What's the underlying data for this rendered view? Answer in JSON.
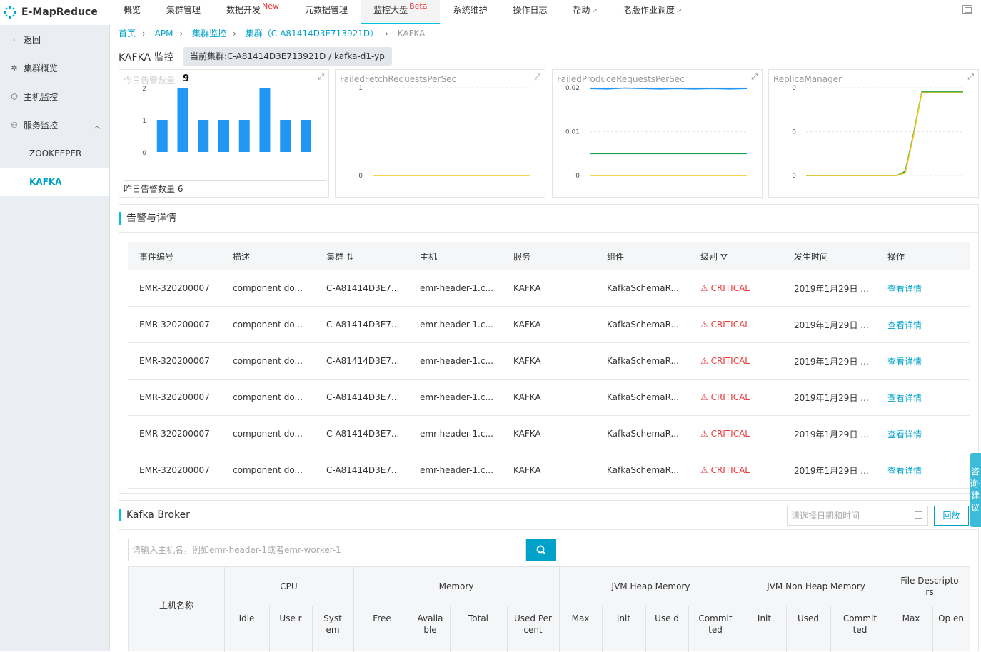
{
  "app": {
    "name": "E-MapReduce"
  },
  "nav": [
    {
      "label": "概览"
    },
    {
      "label": "集群管理"
    },
    {
      "label": "数据开发",
      "tag": "New"
    },
    {
      "label": "元数据管理"
    },
    {
      "label": "监控大盘",
      "tag": "Beta",
      "active": true
    },
    {
      "label": "系统维护"
    },
    {
      "label": "操作日志"
    },
    {
      "label": "帮助",
      "external": true
    },
    {
      "label": "老版作业调度",
      "external": true
    }
  ],
  "sidebar": {
    "back": "返回",
    "items": [
      {
        "label": "集群概览",
        "icon": "cluster-icon"
      },
      {
        "label": "主机监控",
        "icon": "host-icon"
      },
      {
        "label": "服务监控",
        "icon": "user-icon"
      }
    ],
    "subitems": [
      {
        "label": "ZOOKEEPER"
      },
      {
        "label": "KAFKA"
      }
    ]
  },
  "breadcrumb": {
    "items": [
      "首页",
      "APM",
      "集群监控",
      "集群（C-A81414D3E713921D）"
    ],
    "current": "KAFKA"
  },
  "page": {
    "title": "KAFKA 监控",
    "cluster_badge": "当前集群:C-A81414D3E713921D / kafka-d1-yp"
  },
  "charts": {
    "alert": {
      "title": "今日告警数量",
      "count": "9",
      "yesterday": "昨日告警数量 6"
    },
    "fetch": {
      "title": "FailedFetchRequestsPerSec"
    },
    "produce": {
      "title": "FailedProduceRequestsPerSec"
    },
    "replica": {
      "title": "ReplicaManager"
    }
  },
  "chart_data": [
    {
      "type": "bar",
      "title": "今日告警数量",
      "ylim": [
        0,
        2
      ],
      "yticks": [
        "0",
        "1",
        "2"
      ],
      "values": [
        1,
        2,
        1,
        1,
        1,
        2,
        1,
        1
      ],
      "color": "#2196f3"
    },
    {
      "type": "line",
      "title": "FailedFetchRequestsPerSec",
      "yticks": [
        "0",
        "1"
      ],
      "series": [
        {
          "values": [
            0,
            0,
            0,
            0,
            0,
            0,
            0,
            0,
            0,
            0
          ],
          "color": "#f5c518"
        }
      ]
    },
    {
      "type": "line",
      "title": "FailedProduceRequestsPerSec",
      "yticks": [
        "0",
        "0.01",
        "0.02"
      ],
      "ylim": [
        0,
        0.02
      ],
      "series": [
        {
          "values": [
            0.0198,
            0.0197,
            0.0199,
            0.0198,
            0.0197,
            0.0198,
            0.0197,
            0.0198,
            0.0197,
            0.0198
          ],
          "color": "#2196f3"
        },
        {
          "values": [
            0.005,
            0.005,
            0.005,
            0.005,
            0.005,
            0.005,
            0.005,
            0.005,
            0.005,
            0.005
          ],
          "color": "#1ba34a"
        },
        {
          "values": [
            0,
            0,
            0,
            0,
            0,
            0,
            0,
            0,
            0,
            0
          ],
          "color": "#f5c518"
        }
      ]
    },
    {
      "type": "line",
      "title": "ReplicaManager",
      "yticks": [
        "0",
        "0",
        "0"
      ],
      "series": [
        {
          "values": [
            0,
            0,
            0,
            0,
            0,
            0,
            0,
            0,
            0,
            0,
            0,
            0,
            0.05,
            0.5,
            1,
            1,
            1,
            1,
            1,
            1
          ],
          "color": "#1ba34a"
        },
        {
          "values": [
            0,
            0,
            0,
            0,
            0,
            0,
            0,
            0,
            0,
            0,
            0,
            0,
            0.03,
            0.48,
            0.99,
            0.99,
            0.99,
            0.99,
            0.99,
            0.99
          ],
          "color": "#f5c518"
        }
      ]
    }
  ],
  "alerts": {
    "title": "告警与详情",
    "columns": [
      "事件编号",
      "描述",
      "集群",
      "主机",
      "服务",
      "组件",
      "级别",
      "发生时间",
      "操作"
    ],
    "rows": [
      [
        "EMR-320200007",
        "component do...",
        "C-A81414D3E7...",
        "emr-header-1.c...",
        "KAFKA",
        "KafkaSchemaR...",
        "CRITICAL",
        "2019年1月29日 ...",
        "查看详情"
      ],
      [
        "EMR-320200007",
        "component do...",
        "C-A81414D3E7...",
        "emr-header-1.c...",
        "KAFKA",
        "KafkaSchemaR...",
        "CRITICAL",
        "2019年1月29日 ...",
        "查看详情"
      ],
      [
        "EMR-320200007",
        "component do...",
        "C-A81414D3E7...",
        "emr-header-1.c...",
        "KAFKA",
        "KafkaSchemaR...",
        "CRITICAL",
        "2019年1月29日 ...",
        "查看详情"
      ],
      [
        "EMR-320200007",
        "component do...",
        "C-A81414D3E7...",
        "emr-header-1.c...",
        "KAFKA",
        "KafkaSchemaR...",
        "CRITICAL",
        "2019年1月29日 ...",
        "查看详情"
      ],
      [
        "EMR-320200007",
        "component do...",
        "C-A81414D3E7...",
        "emr-header-1.c...",
        "KAFKA",
        "KafkaSchemaR...",
        "CRITICAL",
        "2019年1月29日 ...",
        "查看详情"
      ],
      [
        "EMR-320200007",
        "component do...",
        "C-A81414D3E7...",
        "emr-header-1.c...",
        "KAFKA",
        "KafkaSchemaR...",
        "CRITICAL",
        "2019年1月29日 ...",
        "查看详情"
      ]
    ]
  },
  "broker": {
    "title": "Kafka Broker",
    "date_placeholder": "请选择日期和时间",
    "replay": "回放",
    "search_placeholder": "请输入主机名，例如emr-header-1或者emr-worker-1",
    "host_col": "主机名称",
    "groups": [
      "CPU",
      "Memory",
      "JVM Heap Memory",
      "JVM Non Heap Memory",
      "File Descripto rs"
    ],
    "subcols": [
      "Idle",
      "Use r",
      "Syst em",
      "Free",
      "Availa ble",
      "Total",
      "Used Per cent",
      "Max",
      "Init",
      "Use d",
      "Commit ted",
      "Init",
      "Used",
      "Commit ted",
      "Max",
      "Op en"
    ]
  },
  "float_tab": "咨询·建议"
}
